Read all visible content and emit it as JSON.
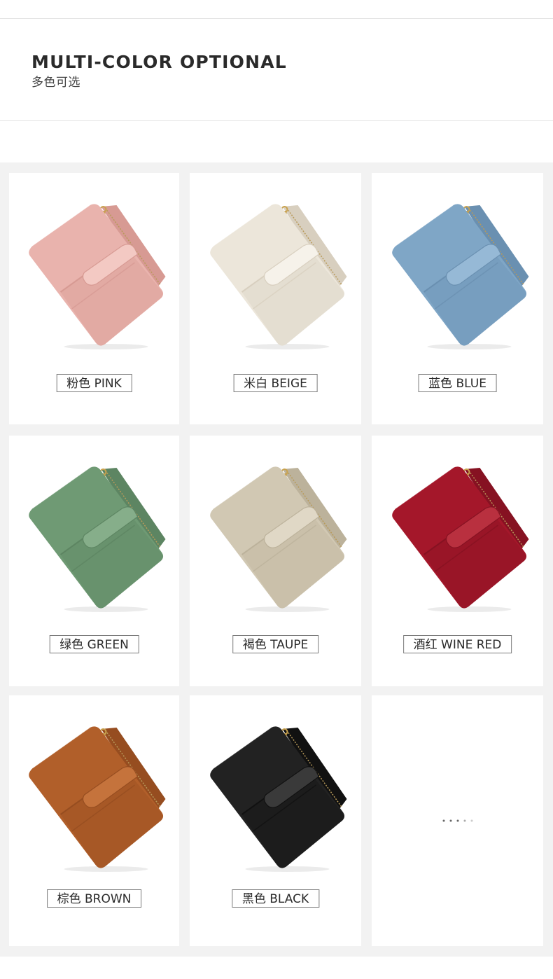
{
  "header": {
    "title": "MULTI-COLOR OPTIONAL",
    "subtitle": "多色可选"
  },
  "products": [
    {
      "label": "粉色 PINK",
      "color": "#e9b3ad",
      "shade": "#d79a93",
      "light": "#f3c9c3"
    },
    {
      "label": "米白 BEIGE",
      "color": "#ece6da",
      "shade": "#d8cfbf",
      "light": "#f6f2ea"
    },
    {
      "label": "蓝色 BLUE",
      "color": "#7fa6c6",
      "shade": "#6a90b1",
      "light": "#96b9d6"
    },
    {
      "label": "绿色 GREEN",
      "color": "#6f9a74",
      "shade": "#5d8562",
      "light": "#86ae8a"
    },
    {
      "label": "褐色 TAUPE",
      "color": "#d1c8b3",
      "shade": "#bcb29b",
      "light": "#e0d8c6"
    },
    {
      "label": "酒红 WINE RED",
      "color": "#a4172a",
      "shade": "#861222",
      "light": "#b9303f"
    },
    {
      "label": "棕色 BROWN",
      "color": "#b15f2a",
      "shade": "#964d20",
      "light": "#c5733c"
    },
    {
      "label": "黑色 BLACK",
      "color": "#222222",
      "shade": "#111111",
      "light": "#3a3a3a"
    }
  ],
  "more_indicator": {
    "icon": "more-dots-icon"
  }
}
